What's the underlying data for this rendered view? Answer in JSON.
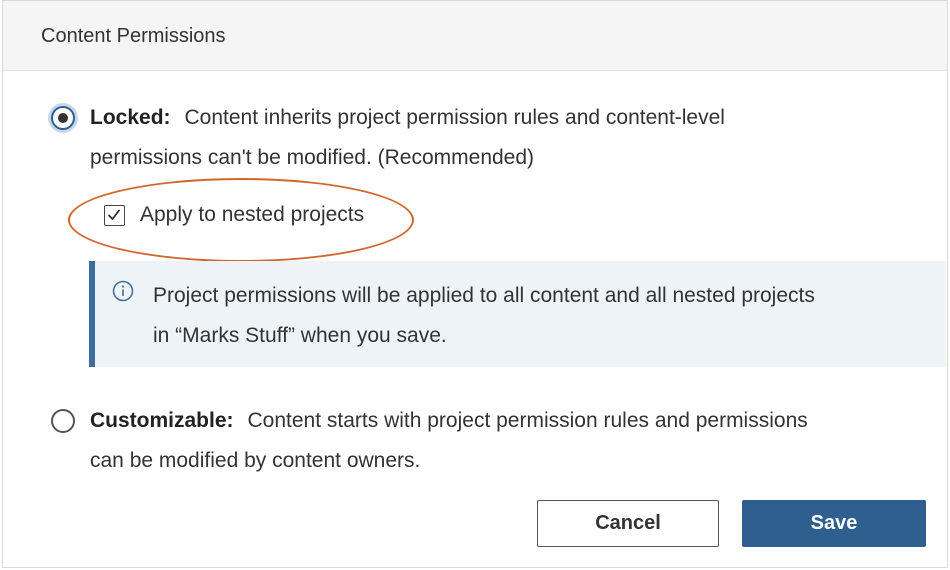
{
  "dialog": {
    "title": "Content Permissions"
  },
  "options": {
    "locked": {
      "label": "Locked:",
      "line1": "Content inherits project permission rules and content-level",
      "line2": "permissions can't be modified. (Recommended)",
      "selected": true
    },
    "nested": {
      "label": "Apply to nested projects",
      "checked": true
    },
    "info": {
      "icon": "info-icon",
      "line1": "Project permissions will be applied to all content and all nested projects",
      "line2": "in “Marks Stuff” when you save."
    },
    "customizable": {
      "label": "Customizable:",
      "line1": "Content starts with project permission rules and permissions",
      "line2": "can be modified by content owners.",
      "selected": false
    }
  },
  "buttons": {
    "cancel": "Cancel",
    "save": "Save"
  },
  "colors": {
    "accent": "#2f5f8f",
    "highlight": "#d2662f",
    "info_bg": "#eef3f8",
    "info_bar": "#3e6d9b"
  }
}
